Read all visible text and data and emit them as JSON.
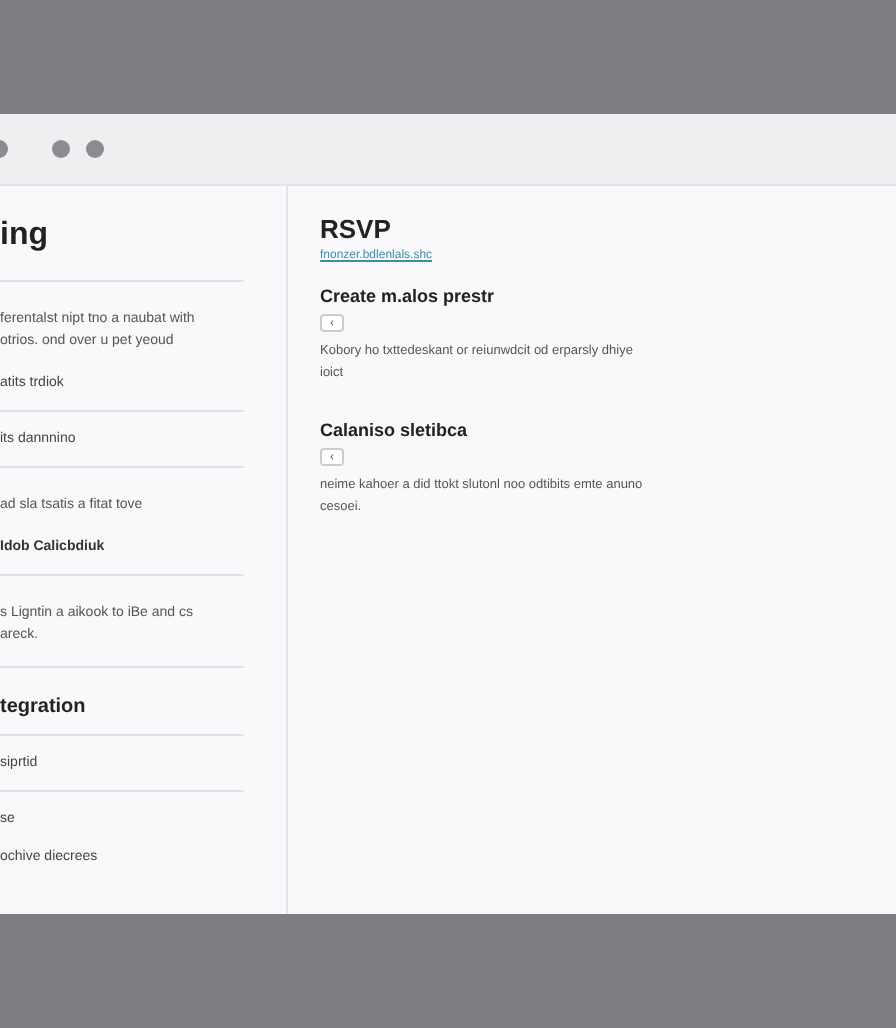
{
  "sidebar": {
    "title": "ing",
    "items": [
      {
        "kind": "para",
        "text": "ferentalst nipt tno a naubat with otrios. ond over u pet yeoud"
      },
      {
        "kind": "row",
        "text": "atits trdiok",
        "divider": true
      },
      {
        "kind": "row",
        "text": "its dannnino",
        "divider": true
      },
      {
        "kind": "para",
        "text": "ad sla tsatis a fitat tove"
      },
      {
        "kind": "strong",
        "text": "Idob Calicbdiuk",
        "divider": true
      },
      {
        "kind": "para",
        "text": "s Ligntin a aikook to iBe and cs areck.",
        "divider": true
      },
      {
        "kind": "heading",
        "text": "tegration",
        "divider": true
      },
      {
        "kind": "row",
        "text": "siprtid",
        "divider": true
      },
      {
        "kind": "row",
        "text": "se"
      },
      {
        "kind": "row",
        "text": "ochive diecrees"
      }
    ]
  },
  "main": {
    "title": "RSVP",
    "link": "fnonzer.bdlenlals.shc",
    "sections": [
      {
        "heading": "Create m.alos prestr",
        "button": "‹",
        "text": "Kobory ho txttedeskant or reiunwdcit od erparsly dhiye ioict"
      },
      {
        "heading": "Calaniso sletibca",
        "button": "‹",
        "text": "neime kahoer a did ttokt slutonl noo odtibits emte anuno cesoei."
      }
    ]
  }
}
